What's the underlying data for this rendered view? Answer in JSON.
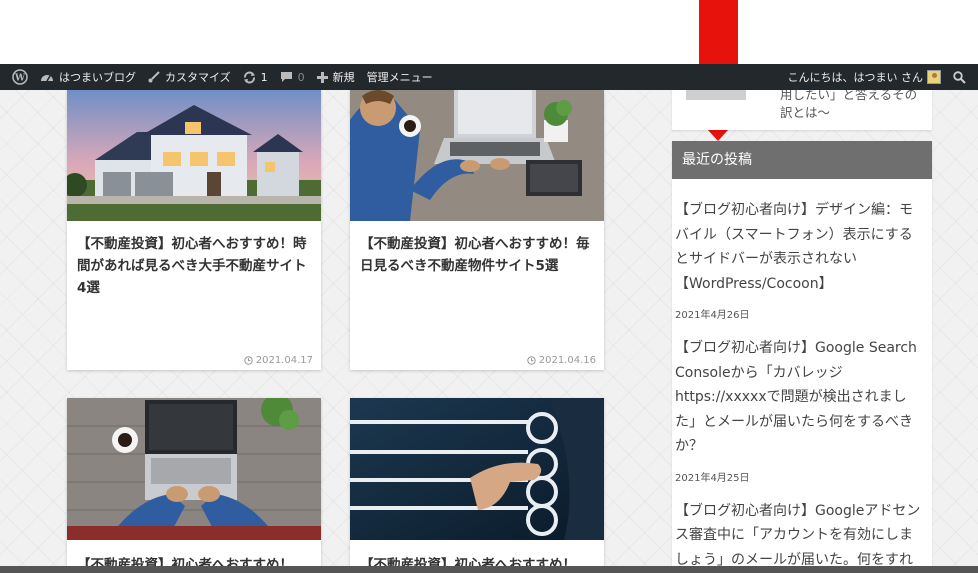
{
  "admin_bar": {
    "site_name": "はつまいブログ",
    "customize": "カスタマイズ",
    "updates": "1",
    "comments": "0",
    "new": "新規",
    "admin_menu": "管理メニュー",
    "greeting": "こんにちは、はつまい さん"
  },
  "cards": [
    {
      "title": "【不動産投資】初心者へおすすめ！時間があれば見るべき大手不動産サイト4選",
      "date": "2021.04.17"
    },
    {
      "title": "【不動産投資】初心者へおすすめ！毎日見るべき不動産物件サイト5選",
      "date": "2021.04.16"
    },
    {
      "title": "【不動産投資】初心者へおすすめ！"
    },
    {
      "title": "【不動産投資】初心者へおすすめ！"
    }
  ],
  "sidebar": {
    "top_snippet_line1": "用したい」と答えるその",
    "top_snippet_line2": "訳とは〜",
    "recent_heading": "最近の投稿",
    "posts": [
      {
        "title": "【ブログ初心者向け】デザイン編：モバイル（スマートフォン）表示にするとサイドバーが表示されない【WordPress/Cocoon】",
        "date": "2021年4月26日"
      },
      {
        "title": "【ブログ初心者向け】Google Search Consoleから「カバレッジ https://xxxxxで問題が検出されました」とメールが届いたら何をするべきか？",
        "date": "2021年4月25日"
      },
      {
        "title": "【ブログ初心者向け】Googleアドセンス審査中に「アカウントを有効にしましょう」のメールが届いた。何をすればい"
      }
    ]
  },
  "colors": {
    "admin_bar": "#23282d",
    "arrow": "#e8120c",
    "sidebar_heading": "#6f6f6f"
  }
}
